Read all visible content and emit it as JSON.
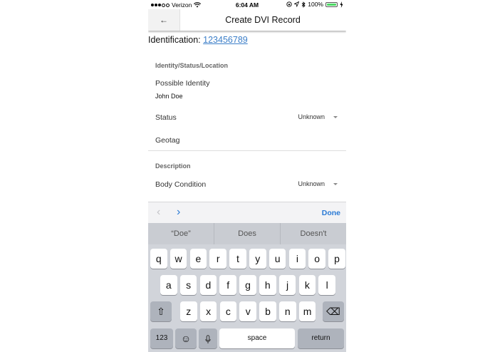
{
  "status_bar": {
    "carrier": "Verizon",
    "time": "6:04 AM",
    "battery_percent": "100%",
    "battery_level": 1.0,
    "signal_dots_filled": 3,
    "signal_dots_total": 5,
    "icons": [
      "wifi-icon",
      "orientation-lock-icon",
      "location-icon",
      "bluetooth-icon",
      "battery-icon",
      "charging-icon"
    ],
    "battery_color": "#4cd964"
  },
  "nav": {
    "back_icon": "←",
    "title": "Create DVI Record"
  },
  "identification": {
    "label": "Identification:",
    "value": "123456789",
    "link_color": "#3b7ec8"
  },
  "sections": {
    "identity": {
      "header": "Identity/Status/Location",
      "possible_identity_label": "Possible Identity",
      "possible_identity_value": "John Doe",
      "status_label": "Status",
      "status_value": "Unknown",
      "geotag_label": "Geotag"
    },
    "description": {
      "header": "Description",
      "body_condition_label": "Body Condition",
      "body_condition_value": "Unknown"
    }
  },
  "accessory": {
    "prev_icon": "‹",
    "next_icon": "›",
    "done_label": "Done",
    "accent_color": "#2a7ad5"
  },
  "keyboard": {
    "suggestions": [
      "“Doe”",
      "Does",
      "Doesn't"
    ],
    "row1": [
      "q",
      "w",
      "e",
      "r",
      "t",
      "y",
      "u",
      "i",
      "o",
      "p"
    ],
    "row2": [
      "a",
      "s",
      "d",
      "f",
      "g",
      "h",
      "j",
      "k",
      "l"
    ],
    "row3": [
      "z",
      "x",
      "c",
      "v",
      "b",
      "n",
      "m"
    ],
    "shift_icon": "⇧",
    "delete_icon": "⌫",
    "numbers_label": "123",
    "emoji_icon": "☺",
    "mic_icon": "🎤",
    "space_label": "space",
    "return_label": "return"
  }
}
